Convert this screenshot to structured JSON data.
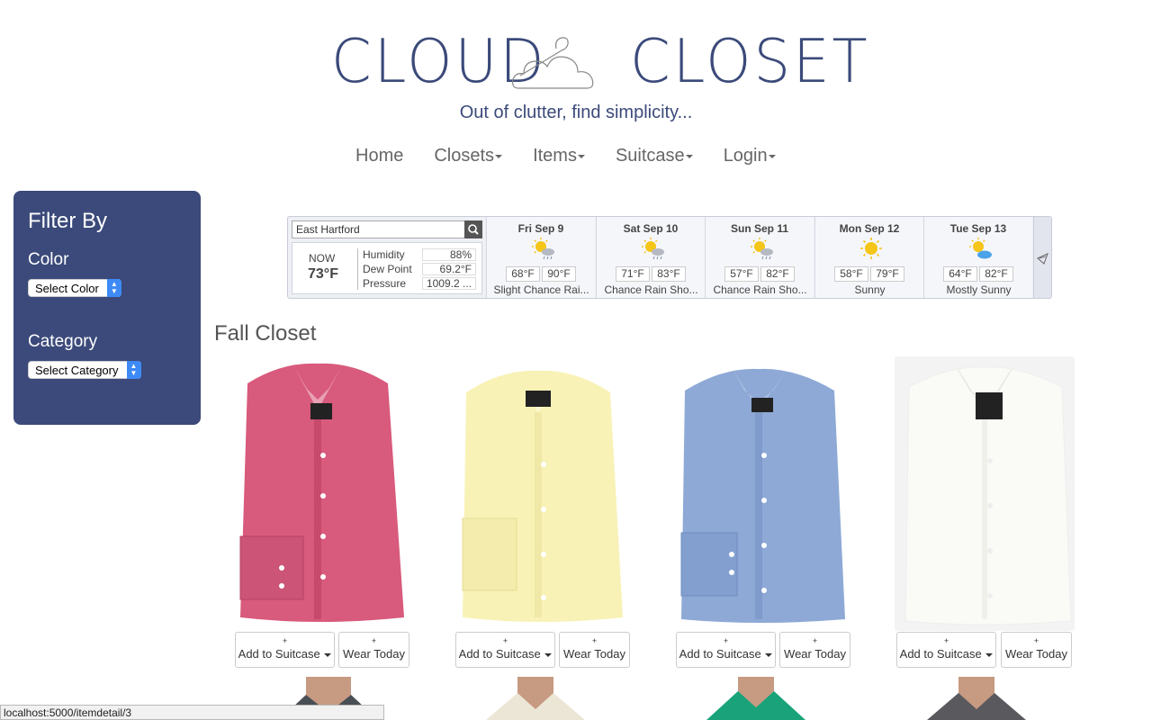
{
  "header": {
    "logo_left": "CLOUD",
    "logo_right": "CLOSET",
    "tagline": "Out of clutter, find simplicity..."
  },
  "nav": {
    "home": "Home",
    "closets": "Closets",
    "items": "Items",
    "suitcase": "Suitcase",
    "login": "Login"
  },
  "sidebar": {
    "title": "Filter By",
    "color_label": "Color",
    "color_select": "Select Color",
    "category_label": "Category",
    "category_select": "Select Category",
    "bg_color": "#3b4a7a"
  },
  "weather": {
    "location": "East Hartford",
    "now_label": "NOW",
    "now_temp": "73°F",
    "humidity_label": "Humidity",
    "humidity": "88%",
    "dewpoint_label": "Dew Point",
    "dewpoint": "69.2°F",
    "pressure_label": "Pressure",
    "pressure": "1009.2 ...",
    "days": [
      {
        "name": "Fri Sep 9",
        "icon": "sun-rain-icon",
        "low": "68°F",
        "high": "90°F",
        "desc": "Slight Chance Rai..."
      },
      {
        "name": "Sat Sep 10",
        "icon": "sun-rain-icon",
        "low": "71°F",
        "high": "83°F",
        "desc": "Chance Rain Sho..."
      },
      {
        "name": "Sun Sep 11",
        "icon": "sun-rain-icon",
        "low": "57°F",
        "high": "82°F",
        "desc": "Chance Rain Sho..."
      },
      {
        "name": "Mon Sep 12",
        "icon": "sun-icon",
        "low": "58°F",
        "high": "79°F",
        "desc": "Sunny"
      },
      {
        "name": "Tue Sep 13",
        "icon": "sun-cloud-icon",
        "low": "64°F",
        "high": "82°F",
        "desc": "Mostly Sunny"
      }
    ]
  },
  "closet": {
    "title": "Fall Closet",
    "items": [
      {
        "name": "pink-shirt",
        "color": "#d85a7c",
        "add_label": "Add to Suitcase",
        "wear_label": "Wear Today",
        "plus": "+"
      },
      {
        "name": "yellow-shirt",
        "color": "#f8f2b6",
        "add_label": "Add to Suitcase",
        "wear_label": "Wear Today",
        "plus": "+"
      },
      {
        "name": "blue-shirt",
        "color": "#8ea9d6",
        "add_label": "Add to Suitcase",
        "wear_label": "Wear Today",
        "plus": "+"
      },
      {
        "name": "white-shirt",
        "color": "#fafaf6",
        "add_label": "Add to Suitcase",
        "wear_label": "Wear Today",
        "plus": "+"
      }
    ]
  },
  "status_url": "localhost:5000/itemdetail/3"
}
